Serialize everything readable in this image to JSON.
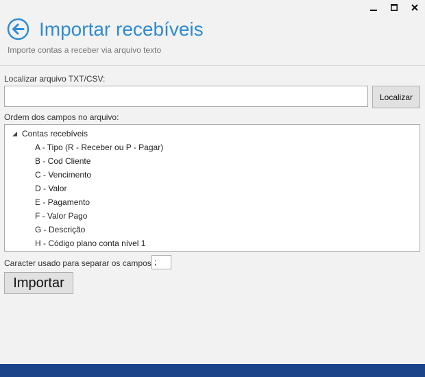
{
  "window": {
    "controls": {
      "minimize": "minimize-icon",
      "maximize": "maximize-icon",
      "close": "close-icon"
    }
  },
  "header": {
    "title": "Importar recebíveis",
    "subtitle": "Importe contas a receber via arquivo texto",
    "back_icon": "back-arrow-icon"
  },
  "file": {
    "label": "Localizar arquivo TXT/CSV:",
    "value": "",
    "button_label": "Localizar"
  },
  "fields": {
    "label": "Ordem dos campos no arquivo:",
    "root": "Contas recebíveis",
    "expanded": true,
    "items": [
      "A - Tipo (R - Receber ou P - Pagar)",
      "B - Cod Cliente",
      "C - Vencimento",
      "D - Valor",
      "E - Pagamento",
      "F - Valor Pago",
      "G - Descrição",
      "H - Código plano conta nível 1"
    ]
  },
  "separator": {
    "label": "Caracter usado para separar os campos:",
    "value": ";"
  },
  "actions": {
    "import_label": "Importar"
  },
  "colors": {
    "accent": "#2f8bd0",
    "footer": "#1c4488",
    "background": "#f2f2f2"
  }
}
